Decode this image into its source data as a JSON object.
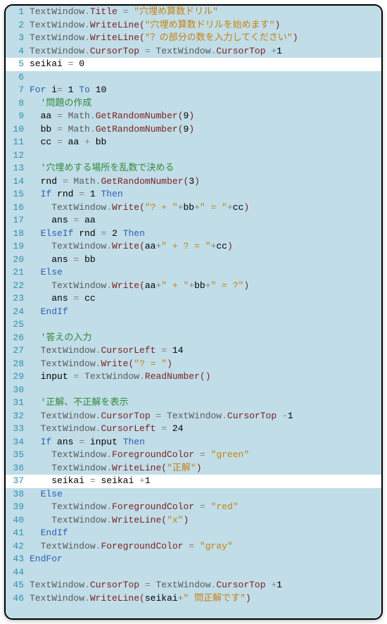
{
  "colors": {
    "bg": "#c1dde8",
    "highlight": "#ffffff",
    "gutter": "#2b91af",
    "object": "#5a5a5a",
    "property": "#7a1f1f",
    "operator": "#808080",
    "string": "#c58210",
    "keyword": "#2d5fb3",
    "comment": "#308a3a"
  },
  "highlighted_lines": [
    5,
    37
  ],
  "lines": [
    {
      "n": 1,
      "indent": 0,
      "tokens": [
        [
          "obj",
          "TextWindow"
        ],
        [
          "dot",
          "."
        ],
        [
          "prop",
          "Title"
        ],
        [
          "plain",
          " "
        ],
        [
          "op",
          "="
        ],
        [
          "plain",
          " "
        ],
        [
          "str",
          "\"穴埋め算数ドリル\""
        ]
      ]
    },
    {
      "n": 2,
      "indent": 0,
      "tokens": [
        [
          "obj",
          "TextWindow"
        ],
        [
          "dot",
          "."
        ],
        [
          "prop",
          "WriteLine"
        ],
        [
          "paren",
          "("
        ],
        [
          "str",
          "\"穴埋め算数ドリルを始めます\""
        ],
        [
          "paren",
          ")"
        ]
      ]
    },
    {
      "n": 3,
      "indent": 0,
      "tokens": [
        [
          "obj",
          "TextWindow"
        ],
        [
          "dot",
          "."
        ],
        [
          "prop",
          "WriteLine"
        ],
        [
          "paren",
          "("
        ],
        [
          "str",
          "\"？の部分の数を入力してください\""
        ],
        [
          "paren",
          ")"
        ]
      ]
    },
    {
      "n": 4,
      "indent": 0,
      "tokens": [
        [
          "obj",
          "TextWindow"
        ],
        [
          "dot",
          "."
        ],
        [
          "prop",
          "CursorTop"
        ],
        [
          "plain",
          " "
        ],
        [
          "op",
          "="
        ],
        [
          "plain",
          " "
        ],
        [
          "obj",
          "TextWindow"
        ],
        [
          "dot",
          "."
        ],
        [
          "prop",
          "CursorTop"
        ],
        [
          "plain",
          " "
        ],
        [
          "op",
          "+"
        ],
        [
          "num",
          "1"
        ]
      ]
    },
    {
      "n": 5,
      "indent": 0,
      "tokens": [
        [
          "var",
          "seikai"
        ],
        [
          "plain",
          " "
        ],
        [
          "op",
          "="
        ],
        [
          "plain",
          " "
        ],
        [
          "num",
          "0"
        ]
      ]
    },
    {
      "n": 6,
      "indent": 0,
      "tokens": []
    },
    {
      "n": 7,
      "indent": 0,
      "tokens": [
        [
          "kw",
          "For"
        ],
        [
          "plain",
          " "
        ],
        [
          "var",
          "i"
        ],
        [
          "op",
          "="
        ],
        [
          "plain",
          " "
        ],
        [
          "num",
          "1"
        ],
        [
          "plain",
          " "
        ],
        [
          "kw",
          "To"
        ],
        [
          "plain",
          " "
        ],
        [
          "num",
          "10"
        ]
      ]
    },
    {
      "n": 8,
      "indent": 2,
      "tokens": [
        [
          "cmt",
          "'問題の作成"
        ]
      ]
    },
    {
      "n": 9,
      "indent": 2,
      "tokens": [
        [
          "var",
          "aa"
        ],
        [
          "plain",
          " "
        ],
        [
          "op",
          "="
        ],
        [
          "plain",
          " "
        ],
        [
          "obj",
          "Math"
        ],
        [
          "dot",
          "."
        ],
        [
          "prop",
          "GetRandomNumber"
        ],
        [
          "paren",
          "("
        ],
        [
          "num",
          "9"
        ],
        [
          "paren",
          ")"
        ]
      ]
    },
    {
      "n": 10,
      "indent": 2,
      "tokens": [
        [
          "var",
          "bb"
        ],
        [
          "plain",
          " "
        ],
        [
          "op",
          "="
        ],
        [
          "plain",
          " "
        ],
        [
          "obj",
          "Math"
        ],
        [
          "dot",
          "."
        ],
        [
          "prop",
          "GetRandomNumber"
        ],
        [
          "paren",
          "("
        ],
        [
          "num",
          "9"
        ],
        [
          "paren",
          ")"
        ]
      ]
    },
    {
      "n": 11,
      "indent": 2,
      "tokens": [
        [
          "var",
          "cc"
        ],
        [
          "plain",
          " "
        ],
        [
          "op",
          "="
        ],
        [
          "plain",
          " "
        ],
        [
          "var",
          "aa"
        ],
        [
          "plain",
          " "
        ],
        [
          "op",
          "+"
        ],
        [
          "plain",
          " "
        ],
        [
          "var",
          "bb"
        ]
      ]
    },
    {
      "n": 12,
      "indent": 0,
      "tokens": []
    },
    {
      "n": 13,
      "indent": 2,
      "tokens": [
        [
          "cmt",
          "'穴埋めする場所を乱数で決める"
        ]
      ]
    },
    {
      "n": 14,
      "indent": 2,
      "tokens": [
        [
          "var",
          "rnd"
        ],
        [
          "plain",
          " "
        ],
        [
          "op",
          "="
        ],
        [
          "plain",
          " "
        ],
        [
          "obj",
          "Math"
        ],
        [
          "dot",
          "."
        ],
        [
          "prop",
          "GetRandomNumber"
        ],
        [
          "paren",
          "("
        ],
        [
          "num",
          "3"
        ],
        [
          "paren",
          ")"
        ]
      ]
    },
    {
      "n": 15,
      "indent": 2,
      "tokens": [
        [
          "kw",
          "If"
        ],
        [
          "plain",
          " "
        ],
        [
          "var",
          "rnd"
        ],
        [
          "plain",
          " "
        ],
        [
          "op",
          "="
        ],
        [
          "plain",
          " "
        ],
        [
          "num",
          "1"
        ],
        [
          "plain",
          " "
        ],
        [
          "kw",
          "Then"
        ]
      ]
    },
    {
      "n": 16,
      "indent": 4,
      "tokens": [
        [
          "obj",
          "TextWindow"
        ],
        [
          "dot",
          "."
        ],
        [
          "prop",
          "Write"
        ],
        [
          "paren",
          "("
        ],
        [
          "str",
          "\"? + \""
        ],
        [
          "op",
          "+"
        ],
        [
          "var",
          "bb"
        ],
        [
          "op",
          "+"
        ],
        [
          "str",
          "\" = \""
        ],
        [
          "op",
          "+"
        ],
        [
          "var",
          "cc"
        ],
        [
          "paren",
          ")"
        ]
      ]
    },
    {
      "n": 17,
      "indent": 4,
      "tokens": [
        [
          "var",
          "ans"
        ],
        [
          "plain",
          " "
        ],
        [
          "op",
          "="
        ],
        [
          "plain",
          " "
        ],
        [
          "var",
          "aa"
        ]
      ]
    },
    {
      "n": 18,
      "indent": 2,
      "tokens": [
        [
          "kw",
          "ElseIf"
        ],
        [
          "plain",
          " "
        ],
        [
          "var",
          "rnd"
        ],
        [
          "plain",
          " "
        ],
        [
          "op",
          "="
        ],
        [
          "plain",
          " "
        ],
        [
          "num",
          "2"
        ],
        [
          "plain",
          " "
        ],
        [
          "kw",
          "Then"
        ]
      ]
    },
    {
      "n": 19,
      "indent": 4,
      "tokens": [
        [
          "obj",
          "TextWindow"
        ],
        [
          "dot",
          "."
        ],
        [
          "prop",
          "Write"
        ],
        [
          "paren",
          "("
        ],
        [
          "var",
          "aa"
        ],
        [
          "op",
          "+"
        ],
        [
          "str",
          "\" + ? = \""
        ],
        [
          "op",
          "+"
        ],
        [
          "var",
          "cc"
        ],
        [
          "paren",
          ")"
        ]
      ]
    },
    {
      "n": 20,
      "indent": 4,
      "tokens": [
        [
          "var",
          "ans"
        ],
        [
          "plain",
          " "
        ],
        [
          "op",
          "="
        ],
        [
          "plain",
          " "
        ],
        [
          "var",
          "bb"
        ]
      ]
    },
    {
      "n": 21,
      "indent": 2,
      "tokens": [
        [
          "kw",
          "Else"
        ]
      ]
    },
    {
      "n": 22,
      "indent": 4,
      "tokens": [
        [
          "obj",
          "TextWindow"
        ],
        [
          "dot",
          "."
        ],
        [
          "prop",
          "Write"
        ],
        [
          "paren",
          "("
        ],
        [
          "var",
          "aa"
        ],
        [
          "op",
          "+"
        ],
        [
          "str",
          "\" + \""
        ],
        [
          "op",
          "+"
        ],
        [
          "var",
          "bb"
        ],
        [
          "op",
          "+"
        ],
        [
          "str",
          "\" = ?\""
        ],
        [
          "paren",
          ")"
        ]
      ]
    },
    {
      "n": 23,
      "indent": 4,
      "tokens": [
        [
          "var",
          "ans"
        ],
        [
          "plain",
          " "
        ],
        [
          "op",
          "="
        ],
        [
          "plain",
          " "
        ],
        [
          "var",
          "cc"
        ]
      ]
    },
    {
      "n": 24,
      "indent": 2,
      "tokens": [
        [
          "kw",
          "EndIf"
        ]
      ]
    },
    {
      "n": 25,
      "indent": 0,
      "tokens": []
    },
    {
      "n": 26,
      "indent": 2,
      "tokens": [
        [
          "cmt",
          "'答えの入力"
        ]
      ]
    },
    {
      "n": 27,
      "indent": 2,
      "tokens": [
        [
          "obj",
          "TextWindow"
        ],
        [
          "dot",
          "."
        ],
        [
          "prop",
          "CursorLeft"
        ],
        [
          "plain",
          " "
        ],
        [
          "op",
          "="
        ],
        [
          "plain",
          " "
        ],
        [
          "num",
          "14"
        ]
      ]
    },
    {
      "n": 28,
      "indent": 2,
      "tokens": [
        [
          "obj",
          "TextWindow"
        ],
        [
          "dot",
          "."
        ],
        [
          "prop",
          "Write"
        ],
        [
          "paren",
          "("
        ],
        [
          "str",
          "\"? = \""
        ],
        [
          "paren",
          ")"
        ]
      ]
    },
    {
      "n": 29,
      "indent": 2,
      "tokens": [
        [
          "var",
          "input"
        ],
        [
          "plain",
          " "
        ],
        [
          "op",
          "="
        ],
        [
          "plain",
          " "
        ],
        [
          "obj",
          "TextWindow"
        ],
        [
          "dot",
          "."
        ],
        [
          "prop",
          "ReadNumber"
        ],
        [
          "paren",
          "("
        ],
        [
          "paren",
          ")"
        ]
      ]
    },
    {
      "n": 30,
      "indent": 0,
      "tokens": []
    },
    {
      "n": 31,
      "indent": 2,
      "tokens": [
        [
          "cmt",
          "'正解、不正解を表示"
        ]
      ]
    },
    {
      "n": 32,
      "indent": 2,
      "tokens": [
        [
          "obj",
          "TextWindow"
        ],
        [
          "dot",
          "."
        ],
        [
          "prop",
          "CursorTop"
        ],
        [
          "plain",
          " "
        ],
        [
          "op",
          "="
        ],
        [
          "plain",
          " "
        ],
        [
          "obj",
          "TextWindow"
        ],
        [
          "dot",
          "."
        ],
        [
          "prop",
          "CursorTop"
        ],
        [
          "plain",
          " "
        ],
        [
          "op",
          "-"
        ],
        [
          "num",
          "1"
        ]
      ]
    },
    {
      "n": 33,
      "indent": 2,
      "tokens": [
        [
          "obj",
          "TextWindow"
        ],
        [
          "dot",
          "."
        ],
        [
          "prop",
          "CursorLeft"
        ],
        [
          "plain",
          " "
        ],
        [
          "op",
          "="
        ],
        [
          "plain",
          " "
        ],
        [
          "num",
          "24"
        ]
      ]
    },
    {
      "n": 34,
      "indent": 2,
      "tokens": [
        [
          "kw",
          "If"
        ],
        [
          "plain",
          " "
        ],
        [
          "var",
          "ans"
        ],
        [
          "plain",
          " "
        ],
        [
          "op",
          "="
        ],
        [
          "plain",
          " "
        ],
        [
          "var",
          "input"
        ],
        [
          "plain",
          " "
        ],
        [
          "kw",
          "Then"
        ]
      ]
    },
    {
      "n": 35,
      "indent": 4,
      "tokens": [
        [
          "obj",
          "TextWindow"
        ],
        [
          "dot",
          "."
        ],
        [
          "prop",
          "ForegroundColor"
        ],
        [
          "plain",
          " "
        ],
        [
          "op",
          "="
        ],
        [
          "plain",
          " "
        ],
        [
          "str",
          "\"green\""
        ]
      ]
    },
    {
      "n": 36,
      "indent": 4,
      "tokens": [
        [
          "obj",
          "TextWindow"
        ],
        [
          "dot",
          "."
        ],
        [
          "prop",
          "WriteLine"
        ],
        [
          "paren",
          "("
        ],
        [
          "str",
          "\"正解\""
        ],
        [
          "paren",
          ")"
        ]
      ]
    },
    {
      "n": 37,
      "indent": 4,
      "tokens": [
        [
          "var",
          "seikai"
        ],
        [
          "plain",
          " "
        ],
        [
          "op",
          "="
        ],
        [
          "plain",
          " "
        ],
        [
          "var",
          "seikai"
        ],
        [
          "plain",
          " "
        ],
        [
          "op",
          "+"
        ],
        [
          "num",
          "1"
        ]
      ]
    },
    {
      "n": 38,
      "indent": 2,
      "tokens": [
        [
          "kw",
          "Else"
        ]
      ]
    },
    {
      "n": 39,
      "indent": 4,
      "tokens": [
        [
          "obj",
          "TextWindow"
        ],
        [
          "dot",
          "."
        ],
        [
          "prop",
          "ForegroundColor"
        ],
        [
          "plain",
          " "
        ],
        [
          "op",
          "="
        ],
        [
          "plain",
          " "
        ],
        [
          "str",
          "\"red\""
        ]
      ]
    },
    {
      "n": 40,
      "indent": 4,
      "tokens": [
        [
          "obj",
          "TextWindow"
        ],
        [
          "dot",
          "."
        ],
        [
          "prop",
          "WriteLine"
        ],
        [
          "paren",
          "("
        ],
        [
          "str",
          "\"x\""
        ],
        [
          "paren",
          ")"
        ]
      ]
    },
    {
      "n": 41,
      "indent": 2,
      "tokens": [
        [
          "kw",
          "EndIf"
        ]
      ]
    },
    {
      "n": 42,
      "indent": 2,
      "tokens": [
        [
          "obj",
          "TextWindow"
        ],
        [
          "dot",
          "."
        ],
        [
          "prop",
          "ForegroundColor"
        ],
        [
          "plain",
          " "
        ],
        [
          "op",
          "="
        ],
        [
          "plain",
          " "
        ],
        [
          "str",
          "\"gray\""
        ]
      ]
    },
    {
      "n": 43,
      "indent": 0,
      "tokens": [
        [
          "kw",
          "EndFor"
        ]
      ]
    },
    {
      "n": 44,
      "indent": 0,
      "tokens": []
    },
    {
      "n": 45,
      "indent": 0,
      "tokens": [
        [
          "obj",
          "TextWindow"
        ],
        [
          "dot",
          "."
        ],
        [
          "prop",
          "CursorTop"
        ],
        [
          "plain",
          " "
        ],
        [
          "op",
          "="
        ],
        [
          "plain",
          " "
        ],
        [
          "obj",
          "TextWindow"
        ],
        [
          "dot",
          "."
        ],
        [
          "prop",
          "CursorTop"
        ],
        [
          "plain",
          " "
        ],
        [
          "op",
          "+"
        ],
        [
          "num",
          "1"
        ]
      ]
    },
    {
      "n": 46,
      "indent": 0,
      "tokens": [
        [
          "obj",
          "TextWindow"
        ],
        [
          "dot",
          "."
        ],
        [
          "prop",
          "WriteLine"
        ],
        [
          "paren",
          "("
        ],
        [
          "var",
          "seikai"
        ],
        [
          "op",
          "+"
        ],
        [
          "str",
          "\" 問正解です\""
        ],
        [
          "paren",
          ")"
        ]
      ]
    }
  ]
}
